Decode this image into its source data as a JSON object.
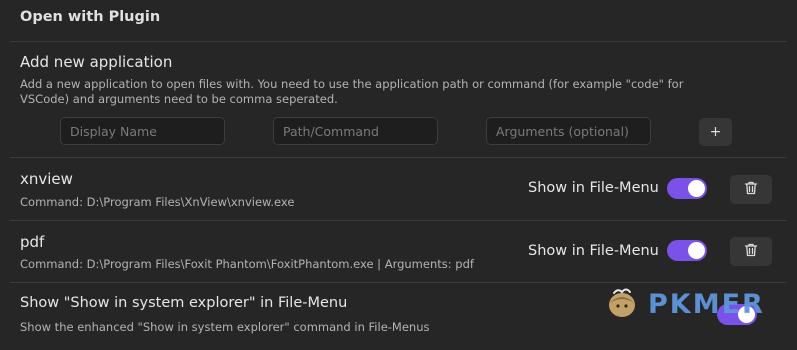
{
  "section": {
    "title": "Open with Plugin"
  },
  "add_application": {
    "title": "Add new application",
    "description": "Add a new application to open files with. You need to use the application path or command (for example \"code\" for VSCode) and arguments need to be comma seperated.",
    "display_name_placeholder": "Display Name",
    "path_placeholder": "Path/Command",
    "arguments_placeholder": "Arguments (optional)",
    "add_button_label": "+"
  },
  "applications": [
    {
      "name": "xnview",
      "command": "Command: D:\\Program Files\\XnView\\xnview.exe",
      "show_in_menu_label": "Show in File-Menu",
      "show_in_menu": true,
      "delete_icon": "trash-icon"
    },
    {
      "name": "pdf",
      "command": "Command: D:\\Program Files\\Foxit Phantom\\FoxitPhantom.exe | Arguments: pdf",
      "show_in_menu_label": "Show in File-Menu",
      "show_in_menu": true,
      "delete_icon": "trash-icon"
    }
  ],
  "system_explorer_setting": {
    "title": "Show \"Show in system explorer\" in File-Menu",
    "description": "Show the enhanced \"Show in system explorer\" command in File-Menus",
    "enabled": true
  },
  "watermark": {
    "text": "PKMER"
  },
  "colors": {
    "background": "#262626",
    "toggle_accent": "#7b52e8",
    "button_bg": "#363636",
    "watermark": "#5f96dc"
  }
}
